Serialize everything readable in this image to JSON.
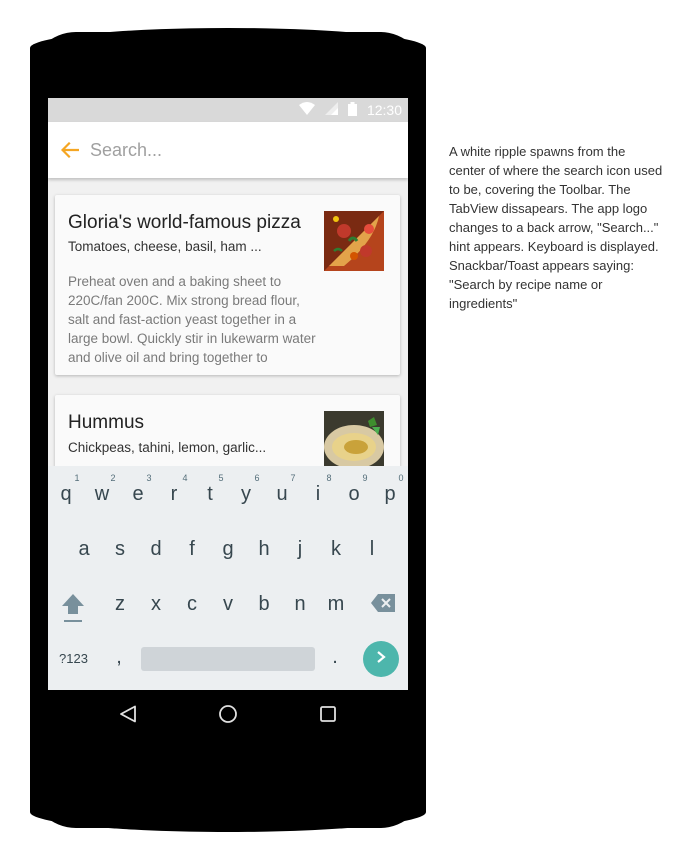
{
  "status_bar": {
    "time": "12:30"
  },
  "search": {
    "placeholder": "Search..."
  },
  "recipes": [
    {
      "title": "Gloria's world-famous pizza",
      "ingredients": "Tomatoes, cheese, basil, ham ...",
      "description": "Preheat oven and a baking sheet to 220C/fan 200C. Mix strong bread flour, salt and fast-action yeast together in a large bowl. Quickly stir in lukewarm water and olive oil and bring together to"
    },
    {
      "title": "Hummus",
      "ingredients": "Chickpeas, tahini, lemon, garlic..."
    }
  ],
  "keyboard": {
    "row1": [
      "q",
      "w",
      "e",
      "r",
      "t",
      "y",
      "u",
      "i",
      "o",
      "p"
    ],
    "row1_numbers": [
      "1",
      "2",
      "3",
      "4",
      "5",
      "6",
      "7",
      "8",
      "9",
      "0"
    ],
    "row2": [
      "a",
      "s",
      "d",
      "f",
      "g",
      "h",
      "j",
      "k",
      "l"
    ],
    "row3": [
      "z",
      "x",
      "c",
      "v",
      "b",
      "n",
      "m"
    ],
    "symbols_label": "?123",
    "comma": ",",
    "period": "."
  },
  "icons": {
    "back": "arrow-left-icon",
    "shift": "shift-icon",
    "backspace": "backspace-icon",
    "enter": "chevron-right-icon",
    "nav_back": "triangle-back-icon",
    "nav_home": "circle-home-icon",
    "nav_recents": "square-recents-icon"
  },
  "colors": {
    "accent": "#f5a623",
    "enter_key": "#4db6ac",
    "status_bar": "#d9d9d9",
    "keyboard_bg": "#eceff1"
  },
  "annotation": {
    "text": "A white ripple spawns from the center of where the search icon used to be, covering the Toolbar. The TabView dissapears. The app logo changes to a back arrow, \"Search...\" hint appears. Keyboard is displayed. Snackbar/Toast appears saying: \"Search by recipe name or ingredients\""
  }
}
